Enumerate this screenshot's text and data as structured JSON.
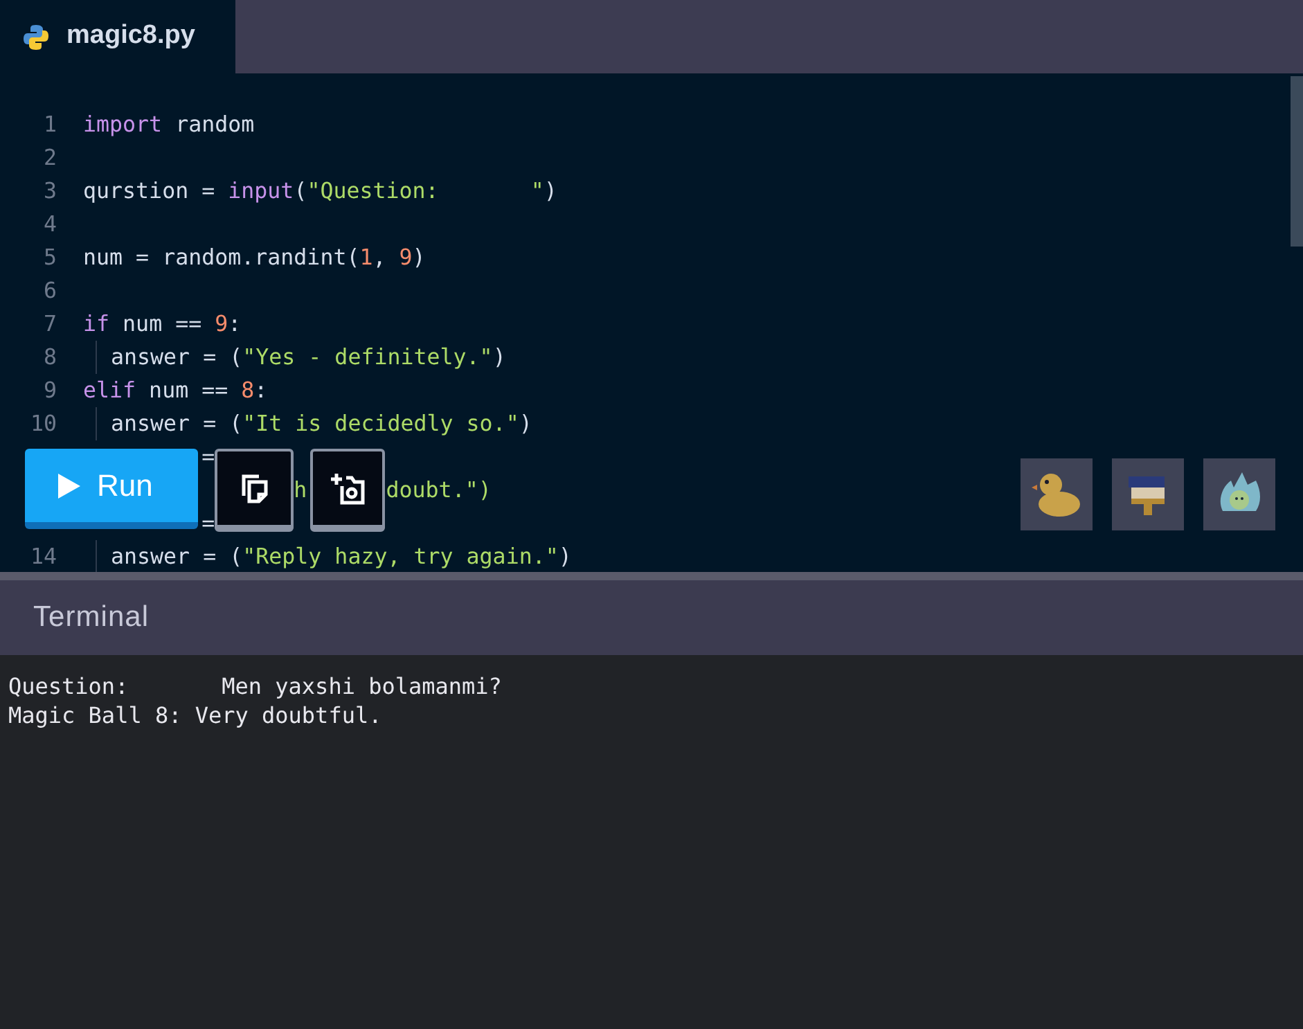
{
  "tabs": [
    {
      "title": "magic8.py",
      "selected": true
    }
  ],
  "editor": {
    "lines": [
      {
        "number": "1",
        "indent": false,
        "tokens": [
          {
            "text": "import",
            "kind": "keyword"
          },
          {
            "text": " random",
            "kind": "plain"
          }
        ]
      },
      {
        "number": "2",
        "indent": false
      },
      {
        "number": "3",
        "indent": false,
        "tokens": [
          {
            "text": "qurstion = ",
            "kind": "plain"
          },
          {
            "text": "input",
            "kind": "keyword"
          },
          {
            "text": "(",
            "kind": "plain"
          },
          {
            "text": "\"Question:       \"",
            "kind": "string"
          },
          {
            "text": ")",
            "kind": "plain"
          }
        ]
      },
      {
        "number": "4",
        "indent": false
      },
      {
        "number": "5",
        "indent": false,
        "tokens": [
          {
            "text": "num = random.randint(",
            "kind": "plain"
          },
          {
            "text": "1",
            "kind": "number"
          },
          {
            "text": ", ",
            "kind": "plain"
          },
          {
            "text": "9",
            "kind": "number"
          },
          {
            "text": ")",
            "kind": "plain"
          }
        ]
      },
      {
        "number": "6",
        "indent": false
      },
      {
        "number": "7",
        "indent": false,
        "tokens": [
          {
            "text": "if",
            "kind": "keyword"
          },
          {
            "text": " num == ",
            "kind": "plain"
          },
          {
            "text": "9",
            "kind": "number"
          },
          {
            "text": ":",
            "kind": "plain"
          }
        ]
      },
      {
        "number": "8",
        "indent": true,
        "tokens": [
          {
            "text": "answer = (",
            "kind": "plain"
          },
          {
            "text": "\"Yes - definitely.\"",
            "kind": "string"
          },
          {
            "text": ")",
            "kind": "plain"
          }
        ]
      },
      {
        "number": "9",
        "indent": false,
        "tokens": [
          {
            "text": "elif",
            "kind": "keyword"
          },
          {
            "text": " num == ",
            "kind": "plain"
          },
          {
            "text": "8",
            "kind": "number"
          },
          {
            "text": ":",
            "kind": "plain"
          }
        ]
      },
      {
        "number": "10",
        "indent": true,
        "tokens": [
          {
            "text": "answer = (",
            "kind": "plain"
          },
          {
            "text": "\"It is decidedly so.\"",
            "kind": "string"
          },
          {
            "text": ")",
            "kind": "plain"
          }
        ]
      },
      {
        "indent": false,
        "tokens": [
          {
            "text": "         =",
            "kind": "plain"
          }
        ]
      },
      {
        "indent": false,
        "tokens": [
          {
            "text": "                h",
            "kind": "string"
          },
          {
            "text": "      doubt.\")",
            "kind": "string"
          }
        ]
      },
      {
        "indent": false,
        "tokens": [
          {
            "text": "         =",
            "kind": "plain"
          }
        ]
      },
      {
        "number": "14",
        "indent": true,
        "tokens": [
          {
            "text": "answer = (",
            "kind": "plain"
          },
          {
            "text": "\"Reply hazy, try again.\"",
            "kind": "string"
          },
          {
            "text": ")",
            "kind": "plain"
          }
        ]
      }
    ]
  },
  "toolbar": {
    "run_label": "Run"
  },
  "terminal": {
    "title": "Terminal",
    "output": [
      "Question:       Men yaxshi bolamanmi?",
      "Magic Ball 8: Very doubtful."
    ]
  }
}
